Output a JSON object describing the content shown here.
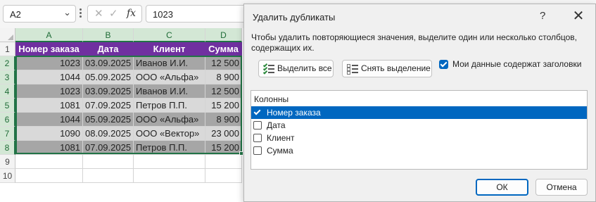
{
  "formula_bar": {
    "name_box": "A2",
    "formula": "1023",
    "icons": [
      "cancel-icon",
      "enter-icon",
      "fx-icon"
    ],
    "fx_label": "fx"
  },
  "sheet": {
    "columns": [
      "A",
      "B",
      "C",
      "D"
    ],
    "rows": [
      "1",
      "2",
      "3",
      "4",
      "5",
      "6",
      "7",
      "8",
      "9",
      "10"
    ],
    "header_row": [
      "Номер заказа",
      "Дата",
      "Клиент",
      "Сумма"
    ],
    "data": [
      [
        "1023",
        "03.09.2025",
        "Иванов И.И.",
        "12 500"
      ],
      [
        "1044",
        "05.09.2025",
        "ООО «Альфа»",
        "8 900"
      ],
      [
        "1023",
        "03.09.2025",
        "Иванов И.И.",
        "12 500"
      ],
      [
        "1081",
        "07.09.2025",
        "Петров П.П.",
        "15 200"
      ],
      [
        "1044",
        "05.09.2025",
        "ООО «Альфа»",
        "8 900"
      ],
      [
        "1090",
        "08.09.2025",
        "ООО «Вектор»",
        "23 000"
      ],
      [
        "1081",
        "07.09.2025",
        "Петров П.П.",
        "15 200"
      ]
    ],
    "colors": {
      "header_bg": "#7030a0",
      "row_dark": "#a6a6a6",
      "row_light": "#d9d9d9",
      "selection": "#217346"
    }
  },
  "dialog": {
    "title": "Удалить дубликаты",
    "help": "?",
    "close": "✕",
    "instruction": "Чтобы удалить повторяющиеся значения, выделите один или несколько столбцов, содержащих их.",
    "select_all": "Выделить все",
    "deselect_all": "Снять выделение",
    "headers_checkbox": {
      "label": "Мои данные содержат заголовки",
      "checked": true
    },
    "columns_label": "Колонны",
    "columns": [
      {
        "label": "Номер заказа",
        "checked": true,
        "selected": true
      },
      {
        "label": "Дата",
        "checked": false,
        "selected": false
      },
      {
        "label": "Клиент",
        "checked": false,
        "selected": false
      },
      {
        "label": "Сумма",
        "checked": false,
        "selected": false
      }
    ],
    "ok": "ОК",
    "cancel": "Отмена",
    "accent": "#0067c0"
  }
}
